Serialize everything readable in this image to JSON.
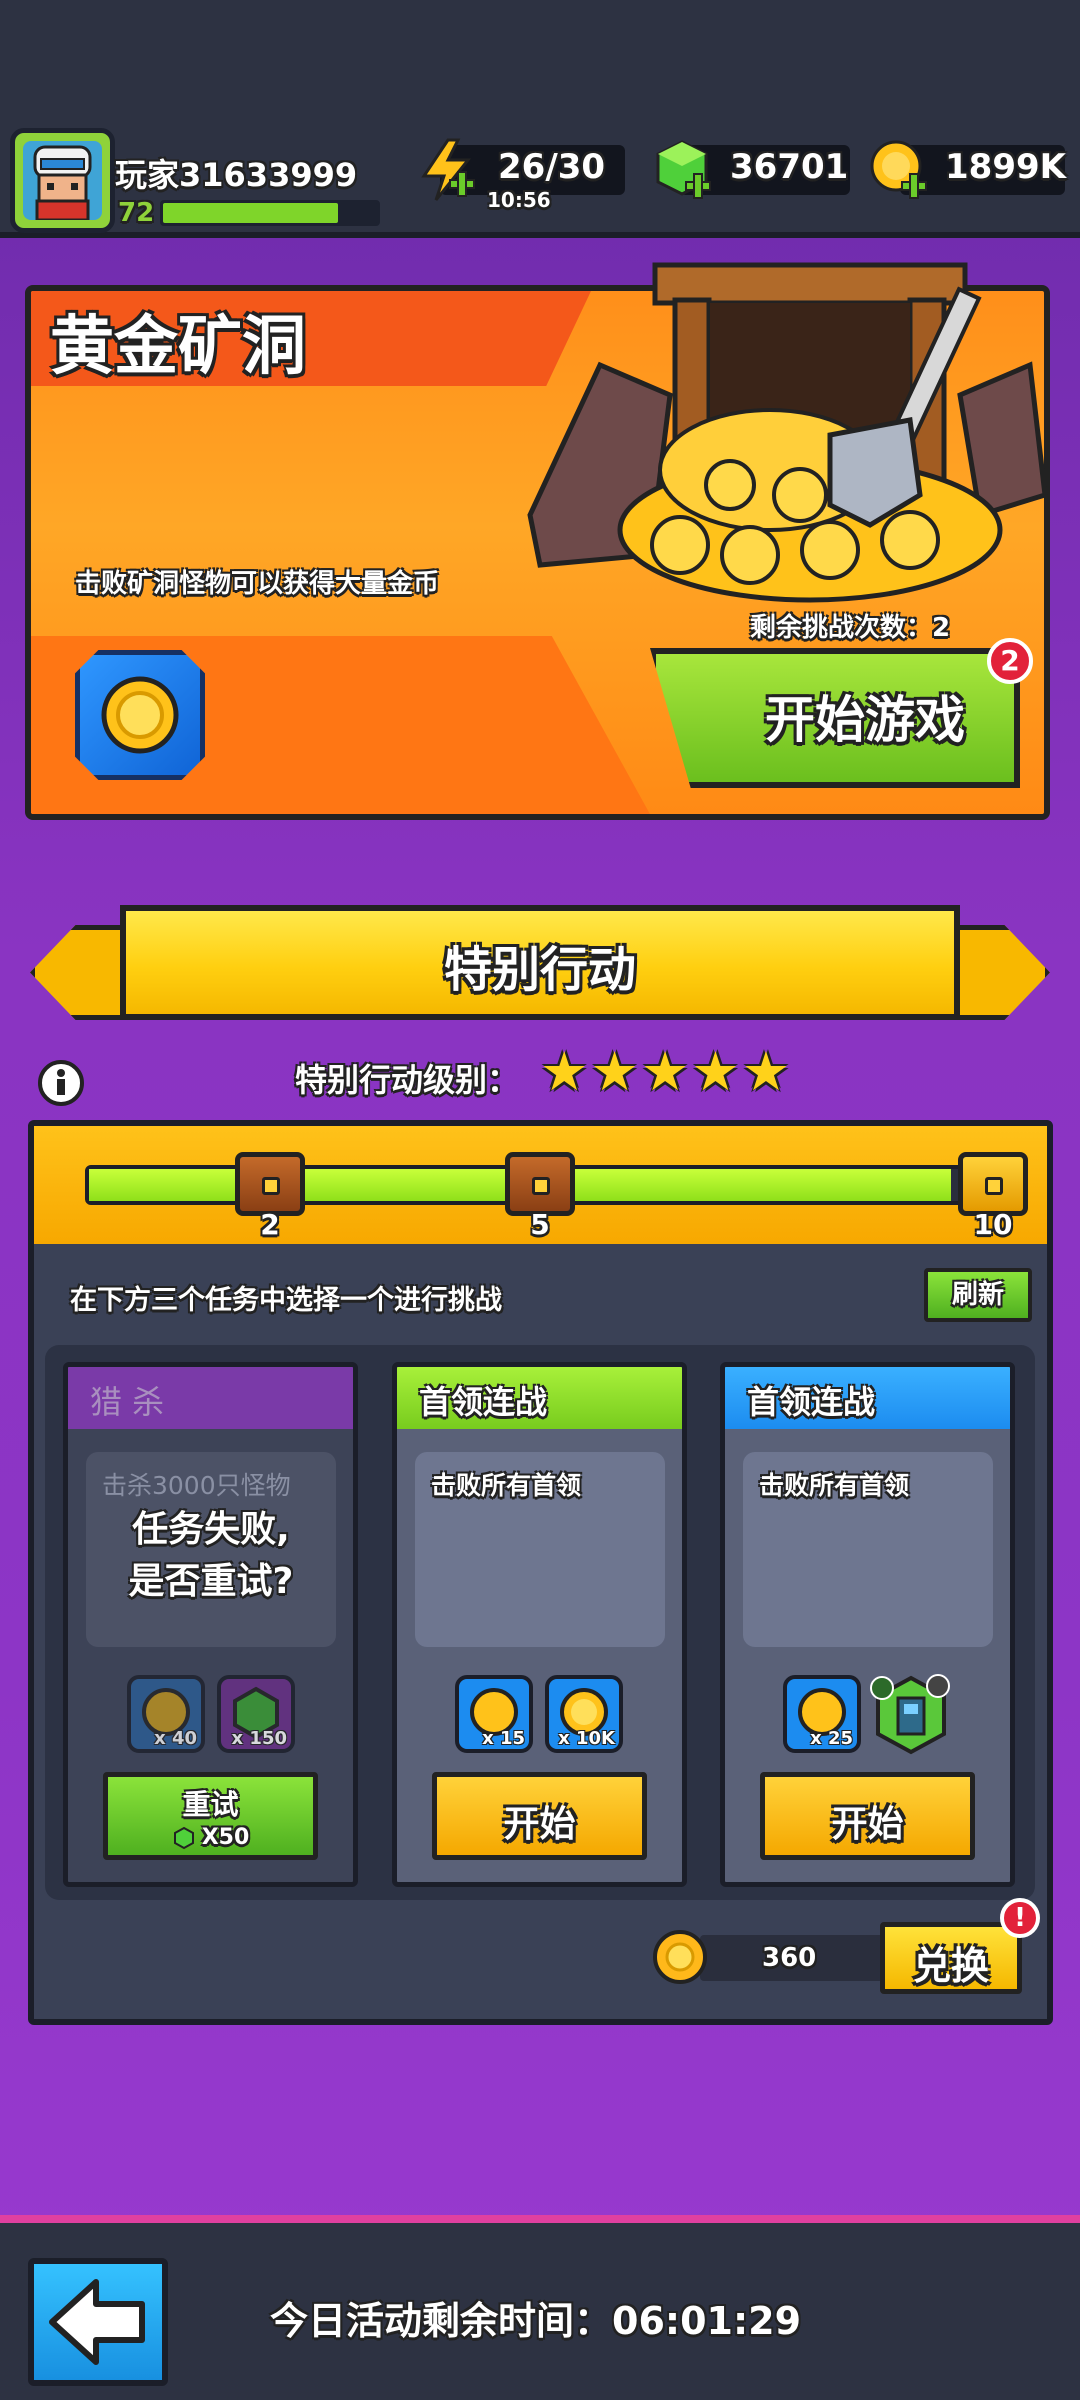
{
  "player": {
    "name": "玩家31633999",
    "level": "72",
    "xp_progress": 0.82
  },
  "resources": {
    "energy": "26/30",
    "energy_timer": "10:56",
    "gems": "36701",
    "gold": "1899K"
  },
  "gold_mine": {
    "title": "黄金矿洞",
    "description": "击败矿洞怪物可以获得大量金币",
    "remaining_label": "剩余挑战次数：2",
    "start_label": "开始游戏",
    "badge": "2"
  },
  "special_action": {
    "title": "特别行动",
    "level_label": "特别行动级别：",
    "stars": 5,
    "progress_fraction": 0.94,
    "milestones": [
      "2",
      "5",
      "10"
    ],
    "choose_text": "在下方三个任务中选择一个进行挑战",
    "refresh_label": "刷新"
  },
  "missions": [
    {
      "title": "猎 杀",
      "task": "击杀3000只怪物",
      "status": "任务失败,\n是否重试?",
      "rewards": [
        {
          "icon": "gold-chest-icon",
          "qty": "x 40"
        },
        {
          "icon": "gem-chest-icon",
          "qty": "x 150"
        }
      ],
      "button": "重试",
      "button_cost": "X50"
    },
    {
      "title": "首领连战",
      "task": "击败所有首领",
      "rewards": [
        {
          "icon": "gold-chest-icon",
          "qty": "x 15"
        },
        {
          "icon": "gold-coin-icon",
          "qty": "x 10K"
        }
      ],
      "button": "开始"
    },
    {
      "title": "首领连战",
      "task": "击败所有首领",
      "rewards": [
        {
          "icon": "gold-chest-icon",
          "qty": "x 25"
        },
        {
          "icon": "equipment-icon",
          "qty": ""
        }
      ],
      "button": "开始"
    }
  ],
  "exchange": {
    "coins": "360",
    "label": "兑换",
    "badge": "!"
  },
  "footer": {
    "timer_label": "今日活动剩余时间：06:01:29"
  },
  "colors": {
    "bg_purple": "#8a34c2",
    "orange": "#ff8f1a",
    "green": "#8fd23a",
    "yellow": "#ffcf10",
    "blue": "#1c8cf0"
  }
}
